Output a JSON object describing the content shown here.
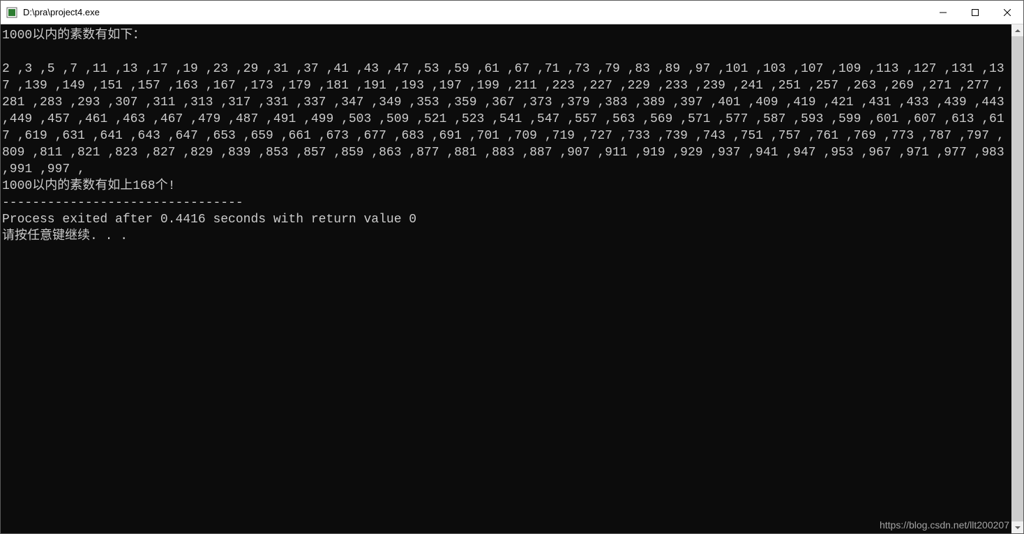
{
  "window": {
    "title": "D:\\pra\\project4.exe"
  },
  "console": {
    "header": "1000以内的素数有如下：",
    "primes": "2 ,3 ,5 ,7 ,11 ,13 ,17 ,19 ,23 ,29 ,31 ,37 ,41 ,43 ,47 ,53 ,59 ,61 ,67 ,71 ,73 ,79 ,83 ,89 ,97 ,101 ,103 ,107 ,109 ,113 ,127 ,131 ,137 ,139 ,149 ,151 ,157 ,163 ,167 ,173 ,179 ,181 ,191 ,193 ,197 ,199 ,211 ,223 ,227 ,229 ,233 ,239 ,241 ,251 ,257 ,263 ,269 ,271 ,277 ,281 ,283 ,293 ,307 ,311 ,313 ,317 ,331 ,337 ,347 ,349 ,353 ,359 ,367 ,373 ,379 ,383 ,389 ,397 ,401 ,409 ,419 ,421 ,431 ,433 ,439 ,443 ,449 ,457 ,461 ,463 ,467 ,479 ,487 ,491 ,499 ,503 ,509 ,521 ,523 ,541 ,547 ,557 ,563 ,569 ,571 ,577 ,587 ,593 ,599 ,601 ,607 ,613 ,617 ,619 ,631 ,641 ,643 ,647 ,653 ,659 ,661 ,673 ,677 ,683 ,691 ,701 ,709 ,719 ,727 ,733 ,739 ,743 ,751 ,757 ,761 ,769 ,773 ,787 ,797 ,809 ,811 ,821 ,823 ,827 ,829 ,839 ,853 ,857 ,859 ,863 ,877 ,881 ,883 ,887 ,907 ,911 ,919 ,929 ,937 ,941 ,947 ,953 ,967 ,971 ,977 ,983 ,991 ,997 ,",
    "footer": "1000以内的素数有如上168个!",
    "separator": "--------------------------------",
    "exit_msg": "Process exited after 0.4416 seconds with return value 0",
    "prompt": "请按任意键继续. . ."
  },
  "watermark": "https://blog.csdn.net/llt200207"
}
